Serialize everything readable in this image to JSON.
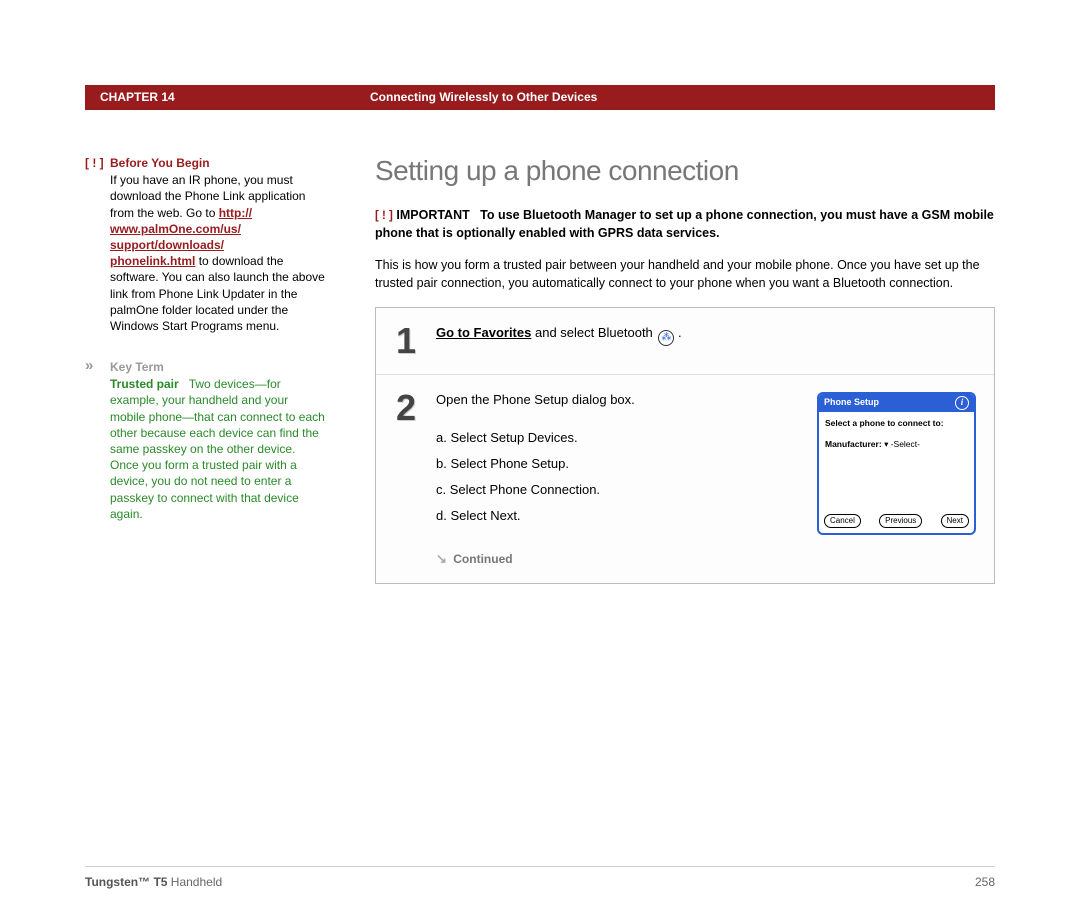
{
  "header": {
    "chapter_label": "CHAPTER 14",
    "chapter_title": "Connecting Wirelessly to Other Devices"
  },
  "sidebar": {
    "before": {
      "marker": "[ ! ]",
      "heading": "Before You Begin",
      "text_before_link": "If you have an IR phone, you must download the Phone Link application from the web. Go to ",
      "link1_text": "http://",
      "link2_text": "www.palmOne.com/us/",
      "link3_text": "support/downloads/",
      "link4_text": "phonelink.html",
      "text_after_link": " to download the software. You can also launch the above link from Phone Link Updater in the palmOne folder located under the Windows Start Programs menu."
    },
    "keyterm": {
      "marker": "»",
      "heading": "Key Term",
      "term": "Trusted pair",
      "definition": "Two devices—for example, your handheld and your mobile phone—that can connect to each other because each device can find the same passkey on the other device. Once you form a trusted pair with a device, you do not need to enter a passkey to connect with that device again."
    }
  },
  "main": {
    "title": "Setting up a phone connection",
    "important": {
      "marker": "[ ! ]",
      "label": "IMPORTANT",
      "text": "To use Bluetooth Manager to set up a phone connection, you must have a GSM mobile phone that is optionally enabled with GPRS data services."
    },
    "intro": "This is how you form a trusted pair between your handheld and your mobile phone. Once you have set up the trusted pair connection, you automatically connect to your phone when you want a Bluetooth connection.",
    "steps": {
      "s1": {
        "num": "1",
        "link_text": "Go to Favorites",
        "rest_text": " and select Bluetooth "
      },
      "s2": {
        "num": "2",
        "lead": "Open the Phone Setup dialog box.",
        "a": "a.  Select Setup Devices.",
        "b": "b.  Select Phone Setup.",
        "c": "c.  Select Phone Connection.",
        "d": "d.  Select Next.",
        "continued": "Continued"
      }
    },
    "mock": {
      "title": "Phone Setup",
      "info": "i",
      "line1": "Select a phone to connect to:",
      "mfr_label": "Manufacturer:",
      "mfr_value": "▾ -Select-",
      "btn_cancel": "Cancel",
      "btn_prev": "Previous",
      "btn_next": "Next"
    }
  },
  "footer": {
    "product_bold": "Tungsten™ T5",
    "product_rest": " Handheld",
    "page": "258"
  }
}
